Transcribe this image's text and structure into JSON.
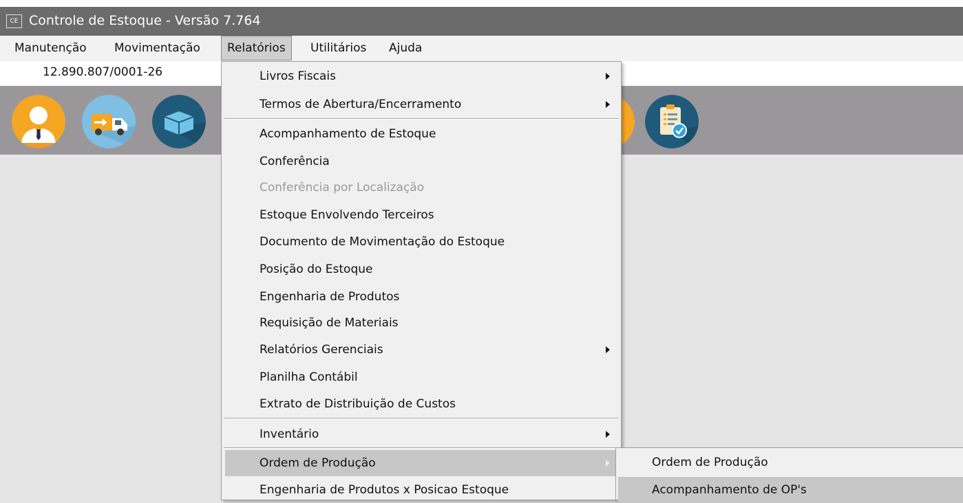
{
  "window": {
    "app_icon_text": "CE",
    "title": "Controle de Estoque - Versão 7.764"
  },
  "menubar": {
    "items": [
      {
        "label": "Manutenção"
      },
      {
        "label": "Movimentação"
      },
      {
        "label": "Relatórios",
        "active": true
      },
      {
        "label": "Utilitários"
      },
      {
        "label": "Ajuda"
      }
    ]
  },
  "infobar": {
    "cnpj": "12.890.807/0001-26"
  },
  "toolbar": {
    "icons": [
      {
        "name": "user-icon"
      },
      {
        "name": "delivery-truck-icon"
      },
      {
        "name": "box-icon"
      },
      {
        "name": "orange-icon"
      },
      {
        "name": "clipboard-check-icon"
      }
    ]
  },
  "menu": {
    "items": [
      {
        "label": "Livros Fiscais",
        "submenu": true
      },
      {
        "label": "Termos de Abertura/Encerramento",
        "submenu": true
      },
      {
        "label": "Acompanhamento de Estoque"
      },
      {
        "label": "Conferência"
      },
      {
        "label": "Conferência por Localização",
        "disabled": true
      },
      {
        "label": "Estoque Envolvendo Terceiros"
      },
      {
        "label": "Documento de Movimentação do Estoque"
      },
      {
        "label": "Posição do Estoque"
      },
      {
        "label": "Engenharia de Produtos"
      },
      {
        "label": "Requisição de Materiais"
      },
      {
        "label": "Relatórios Gerenciais",
        "submenu": true
      },
      {
        "label": "Planilha Contábil"
      },
      {
        "label": "Extrato de Distribuição de Custos"
      },
      {
        "label": "Inventário",
        "submenu": true
      },
      {
        "label": "Ordem de Produção",
        "submenu": true,
        "highlighted": true
      },
      {
        "label": "Engenharia de Produtos x Posicao Estoque"
      }
    ]
  },
  "submenu": {
    "items": [
      {
        "label": "Ordem de Produção"
      },
      {
        "label": "Acompanhamento de OP's",
        "highlighted": true
      }
    ]
  }
}
